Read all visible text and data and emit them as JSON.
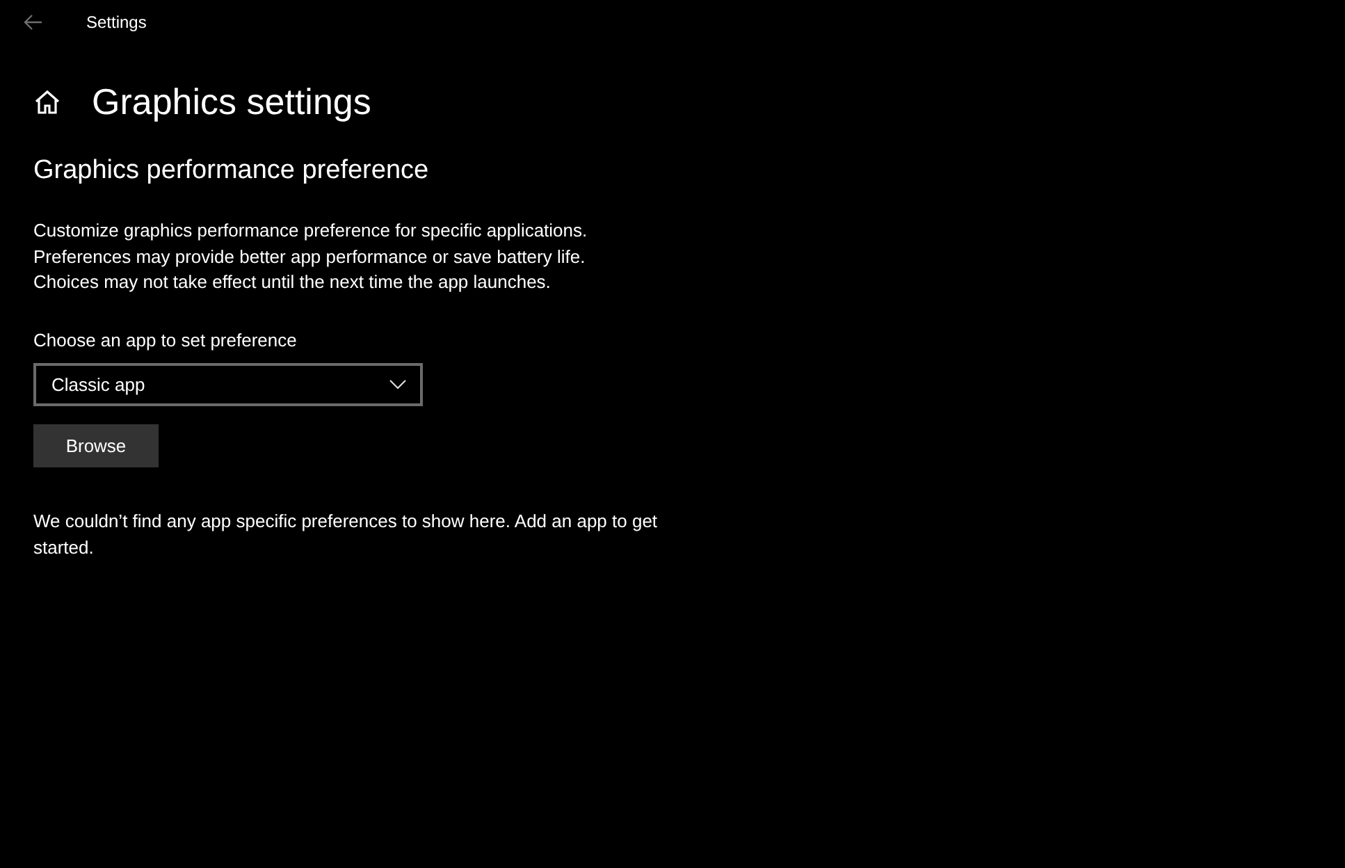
{
  "window": {
    "title": "Settings"
  },
  "page": {
    "title": "Graphics settings"
  },
  "section": {
    "title": "Graphics performance preference",
    "description": [
      "Customize graphics performance preference for specific applications.",
      "Preferences may provide better app performance or save battery life.",
      "Choices may not take effect until the next time the app launches."
    ],
    "dropdown": {
      "label": "Choose an app to set preference",
      "value": "Classic app"
    },
    "buttons": [
      "Browse"
    ],
    "empty_message": "We couldn’t find any app specific preferences to show here. Add an app to get started."
  }
}
